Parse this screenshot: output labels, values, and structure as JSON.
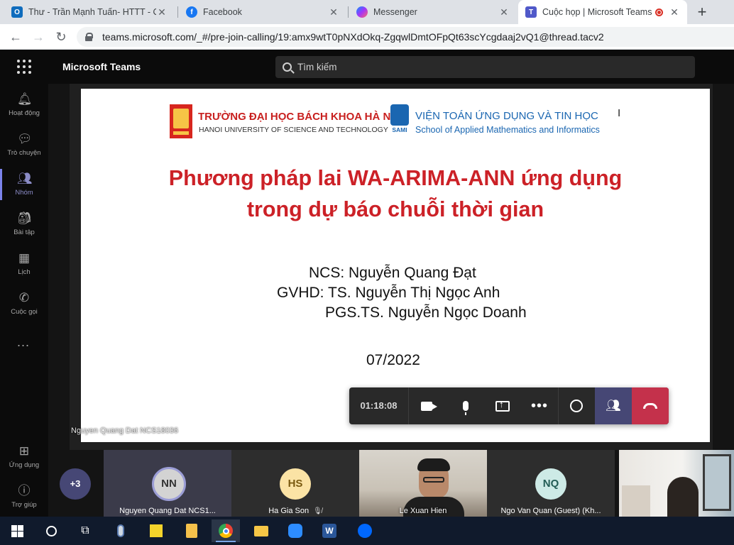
{
  "browser": {
    "tabs": [
      {
        "title": "Thư - Trần Mạnh Tuấn- HTTT - O",
        "icon": "outlook-icon",
        "color": "#0f6cbd"
      },
      {
        "title": "Facebook",
        "icon": "facebook-icon",
        "color": "#1877f2"
      },
      {
        "title": "Messenger",
        "icon": "messenger-icon",
        "color": "#a334fa"
      },
      {
        "title": "Cuộc họp | Microsoft Teams",
        "icon": "teams-icon",
        "color": "#5059c9"
      }
    ],
    "url": "teams.microsoft.com/_#/pre-join-calling/19:amx9wtT0pNXdOkq-ZgqwlDmtOFpQt63scYcgdaaj2vQ1@thread.tacv2"
  },
  "teams": {
    "app_title": "Microsoft Teams",
    "search_placeholder": "Tìm kiếm",
    "rail": [
      {
        "label": "Hoạt động",
        "icon": "bell-icon"
      },
      {
        "label": "Trò chuyện",
        "icon": "chat-icon"
      },
      {
        "label": "Nhóm",
        "icon": "teams-group-icon"
      },
      {
        "label": "Bài tập",
        "icon": "assignments-icon"
      },
      {
        "label": "Lịch",
        "icon": "calendar-icon"
      },
      {
        "label": "Cuộc gọi",
        "icon": "phone-icon"
      }
    ],
    "rail_more": "...",
    "rail_bottom": [
      {
        "label": "Ứng dụng",
        "icon": "apps-icon"
      },
      {
        "label": "Trợ giúp",
        "icon": "help-icon"
      }
    ]
  },
  "slide": {
    "uni_vn": "TRƯỜNG ĐẠI HỌC BÁCH KHOA HÀ NỘI",
    "uni_en": "HANOI UNIVERSITY OF SCIENCE AND TECHNOLOGY",
    "sami": "SAMI",
    "inst_vn": "VIỆN TOÁN ỨNG DỤNG VÀ TIN HỌC",
    "inst_en": "School of Applied Mathematics and Informatics",
    "title_line1": "Phương pháp lai WA-ARIMA-ANN ứng dụng",
    "title_line2": "trong dự báo chuỗi thời gian",
    "ncs": "NCS: Nguyễn Quang Đạt",
    "gvhd1": "GVHD: TS. Nguyễn Thị Ngọc Anh",
    "gvhd2": "PGS.TS. Nguyễn Ngọc Doanh",
    "date": "07/2022"
  },
  "speaker_label": "Nguyen Quang Dat NCS18036",
  "controls": {
    "timer": "01:18:08"
  },
  "participants": {
    "overflow": "+3",
    "tiles": [
      {
        "initials": "NN",
        "name": "Nguyen Quang Dat NCS1...",
        "avatar_color": "#d3d3d3",
        "text_color": "#333"
      },
      {
        "initials": "HS",
        "name": "Ha Gia Son",
        "avatar_color": "#fbe3a5",
        "text_color": "#7a5a10",
        "muted": true
      },
      {
        "initials": "",
        "name": "Le Xuan Hien",
        "video": true
      },
      {
        "initials": "NQ",
        "name": "Ngo Van Quan (Guest) (Kh...",
        "avatar_color": "#cdeae6",
        "text_color": "#235d56"
      },
      {
        "initials": "",
        "name": "",
        "video": true
      }
    ]
  },
  "colors": {
    "accent": "#6264a7",
    "leave": "#c4314b",
    "slide_title": "#cc2127",
    "institute_blue": "#1a66b1"
  }
}
